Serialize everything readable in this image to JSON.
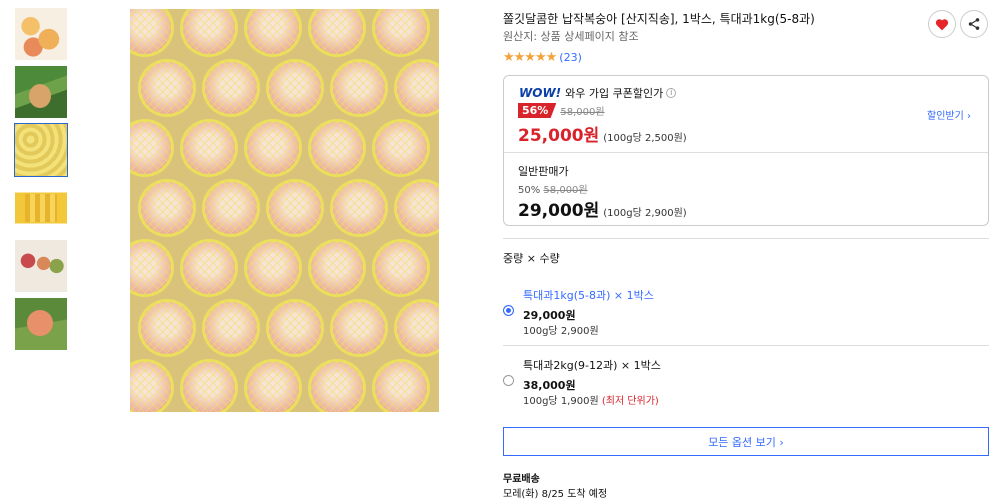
{
  "product": {
    "title": "쫄깃달콤한 납작복숭아 [산지직송], 1박스, 특대과1kg(5-8과)",
    "origin": "원산지: 상품 상세페이지 참조",
    "rating_stars": "★★★★★",
    "review_count": "(23)"
  },
  "actions": {
    "heart_icon": "heart-icon",
    "share_icon": "share-icon"
  },
  "price": {
    "wow_logo": "WOW!",
    "wow_label": "와우 가입 쿠폰할인가",
    "wow_discount": "56%",
    "wow_original": "58,000원",
    "wow_price": "25,000원",
    "wow_unit": "(100g당 2,500원)",
    "coupon_link": "할인받기 ›",
    "general_label": "일반판매가",
    "general_discount": "50%",
    "general_original": "58,000원",
    "general_price": "29,000원",
    "general_unit": "(100g당 2,900원)"
  },
  "options": {
    "header": "중량 × 수량",
    "items": [
      {
        "name": "특대과1kg(5-8과)  ×  1박스",
        "price": "29,000원",
        "unit": "100g당 2,900원",
        "note": "",
        "selected": true
      },
      {
        "name": "특대과2kg(9-12과)  ×  1박스",
        "price": "38,000원",
        "unit": "100g당 1,900원",
        "note": "(최저 단위가)",
        "selected": false
      }
    ],
    "all_button": "모든 옵션 보기 ›"
  },
  "shipping": {
    "title": "무료배송",
    "eta": "모레(화) 8/25 도착 예정"
  },
  "colors": {
    "accent": "#346aff",
    "sale": "#d8232a",
    "star": "#f4a23a"
  }
}
